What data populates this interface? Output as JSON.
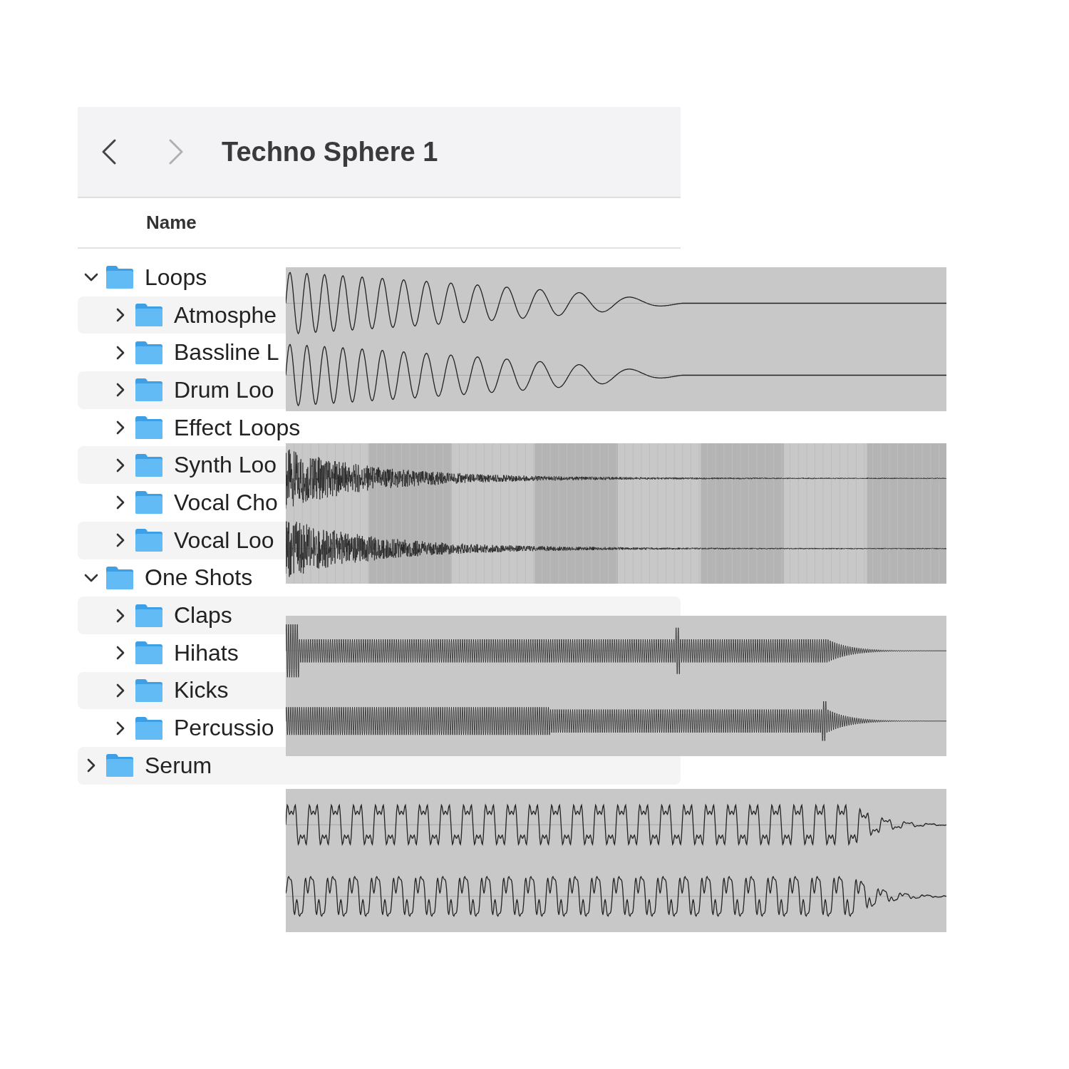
{
  "window": {
    "title": "Techno Sphere 1"
  },
  "nav": {
    "back_disabled": false,
    "forward_disabled": true
  },
  "column_header": "Name",
  "tree": [
    {
      "name": "Loops",
      "expanded": true,
      "children": [
        {
          "name": "Atmosphe",
          "expanded": false
        },
        {
          "name": "Bassline L",
          "expanded": false
        },
        {
          "name": "Drum Loo",
          "expanded": false
        },
        {
          "name": "Effect Loops",
          "expanded": false
        },
        {
          "name": "Synth Loo",
          "expanded": false
        },
        {
          "name": "Vocal Cho",
          "expanded": false
        },
        {
          "name": "Vocal Loo",
          "expanded": false
        }
      ]
    },
    {
      "name": "One Shots",
      "expanded": true,
      "children": [
        {
          "name": "Claps",
          "expanded": false
        },
        {
          "name": "Hihats",
          "expanded": false
        },
        {
          "name": "Kicks",
          "expanded": false
        },
        {
          "name": "Percussio",
          "expanded": false
        }
      ]
    },
    {
      "name": "Serum",
      "expanded": false
    }
  ],
  "waveforms": [
    {
      "kind": "chirp"
    },
    {
      "kind": "noise"
    },
    {
      "kind": "tone"
    },
    {
      "kind": "pulse"
    }
  ]
}
